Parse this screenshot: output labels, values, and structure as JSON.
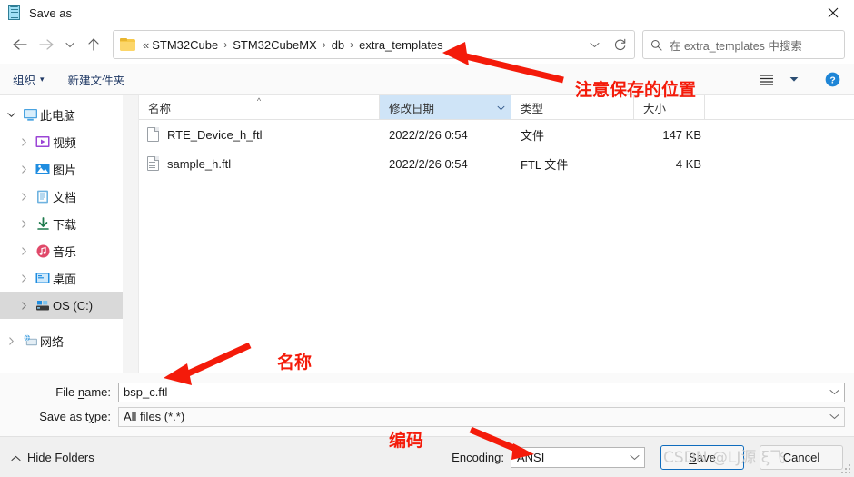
{
  "window": {
    "title": "Save as",
    "title_icon": "notepad-icon",
    "close_icon": "close-icon"
  },
  "navbar": {
    "back_icon": "arrow-left-icon",
    "forward_icon": "arrow-right-icon",
    "recent_icon": "chevron-down-icon",
    "up_icon": "arrow-up-icon",
    "breadcrumb": {
      "folder_icon": "folder-icon",
      "overflow": "«",
      "separator": "›",
      "items": [
        "STM32Cube",
        "STM32CubeMX",
        "db",
        "extra_templates"
      ]
    },
    "history_chevron_icon": "chevron-down-icon",
    "refresh_icon": "refresh-icon",
    "search": {
      "icon": "search-icon",
      "placeholder": "在 extra_templates 中搜索"
    }
  },
  "commandbar": {
    "organize_label": "组织",
    "organize_caret": "▾",
    "new_folder_label": "新建文件夹",
    "view_icon": "list-view-icon",
    "view_caret_icon": "chevron-down-icon",
    "help_icon": "help-circle-icon"
  },
  "nav_pane": {
    "items": [
      {
        "label": "此电脑",
        "icon": "this-pc-icon",
        "level": 0,
        "expanded": true,
        "selected": false
      },
      {
        "label": "视频",
        "icon": "videos-icon",
        "level": 1,
        "expanded": false,
        "selected": false
      },
      {
        "label": "图片",
        "icon": "pictures-icon",
        "level": 1,
        "expanded": false,
        "selected": false
      },
      {
        "label": "文档",
        "icon": "documents-icon",
        "level": 1,
        "expanded": false,
        "selected": false
      },
      {
        "label": "下载",
        "icon": "downloads-icon",
        "level": 1,
        "expanded": false,
        "selected": false
      },
      {
        "label": "音乐",
        "icon": "music-icon",
        "level": 1,
        "expanded": false,
        "selected": false
      },
      {
        "label": "桌面",
        "icon": "desktop-icon",
        "level": 1,
        "expanded": false,
        "selected": false
      },
      {
        "label": "OS (C:)",
        "icon": "drive-icon",
        "level": 1,
        "expanded": false,
        "selected": true
      },
      {
        "label": "网络",
        "icon": "network-icon",
        "level": 0,
        "expanded": false,
        "selected": false
      }
    ]
  },
  "file_list": {
    "columns": [
      {
        "key": "name",
        "label": "名称",
        "active": false,
        "sorted": true
      },
      {
        "key": "date",
        "label": "修改日期",
        "active": true,
        "sorted": false
      },
      {
        "key": "type",
        "label": "类型",
        "active": false,
        "sorted": false
      },
      {
        "key": "size",
        "label": "大小",
        "active": false,
        "sorted": false
      }
    ],
    "rows": [
      {
        "name": "RTE_Device_h_ftl",
        "date": "2022/2/26 0:54",
        "type": "文件",
        "size": "147 KB",
        "icon": "blank-file-icon"
      },
      {
        "name": "sample_h.ftl",
        "date": "2022/2/26 0:54",
        "type": "FTL 文件",
        "size": "4 KB",
        "icon": "text-file-icon"
      }
    ]
  },
  "form": {
    "filename_label_pre": "File ",
    "filename_label_key": "n",
    "filename_label_post": "ame:",
    "filename_value": "bsp_c.ftl",
    "savetype_label_pre": "Save as t",
    "savetype_label_key": "y",
    "savetype_label_post": "pe:",
    "savetype_value": "All files  (*.*)",
    "chevron_icon": "chevron-down-icon"
  },
  "footer": {
    "hide_folders_label": "Hide Folders",
    "hide_folders_icon": "chevron-up-icon",
    "encoding_label": "Encoding:",
    "encoding_value": "ANSI",
    "encoding_chevron_icon": "chevron-down-icon",
    "save_key": "S",
    "save_label_rest": "ave",
    "cancel_label": "Cancel",
    "resize_grip_icon": "resize-grip-icon"
  },
  "annotations": {
    "accent_color": "#f41b0a",
    "location_note": "注意保存的位置",
    "name_note": "名称",
    "encoding_note": "编码"
  },
  "watermark": {
    "text": "CSDN @LJ源 ξ飞"
  }
}
